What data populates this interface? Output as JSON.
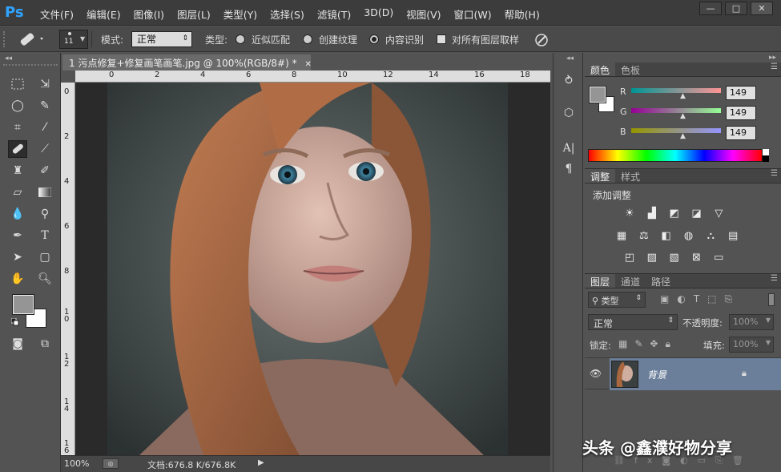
{
  "app": {
    "logo": "Ps"
  },
  "menu": [
    "文件(F)",
    "编辑(E)",
    "图像(I)",
    "图层(L)",
    "类型(Y)",
    "选择(S)",
    "滤镜(T)",
    "3D(D)",
    "视图(V)",
    "窗口(W)",
    "帮助(H)"
  ],
  "window_controls": {
    "minimize": "—",
    "restore": "□",
    "close": "✕"
  },
  "options": {
    "brush_size": "11",
    "mode_label": "模式:",
    "mode_value": "正常",
    "type_label": "类型:",
    "type_options": [
      "近似匹配",
      "创建纹理",
      "内容识别"
    ],
    "selected_type": "内容识别",
    "sample_all_label": "对所有图层取样"
  },
  "document": {
    "tab_title": "1 污点修复+修复画笔画笔.jpg @ 100%(RGB/8#) *",
    "ruler_top": [
      "0",
      "2",
      "4",
      "6",
      "8",
      "10",
      "12",
      "14",
      "16",
      "18"
    ],
    "ruler_left": [
      "0",
      "2",
      "4",
      "6",
      "8",
      "1\n0",
      "1\n2",
      "1\n4",
      "1\n6"
    ],
    "zoom": "100%",
    "doc_info": "文档:676.8 K/676.8K"
  },
  "color_panel": {
    "tabs": [
      "颜色",
      "色板"
    ],
    "channels": [
      {
        "label": "R",
        "value": "149"
      },
      {
        "label": "G",
        "value": "149"
      },
      {
        "label": "B",
        "value": "149"
      }
    ],
    "foreground": "#959595",
    "background": "#ffffff"
  },
  "adjust_panel": {
    "tabs": [
      "调整",
      "样式"
    ],
    "heading": "添加调整"
  },
  "layers_panel": {
    "tabs": [
      "图层",
      "通道",
      "路径"
    ],
    "filter_label": "类型",
    "blend_mode": "正常",
    "opacity_label": "不透明度:",
    "opacity_value": "100%",
    "lock_label": "锁定:",
    "fill_label": "填充:",
    "fill_value": "100%",
    "layers": [
      {
        "name": "背景",
        "visible": true,
        "locked": true
      }
    ]
  },
  "watermark": "头条 @鑫濮好物分享"
}
